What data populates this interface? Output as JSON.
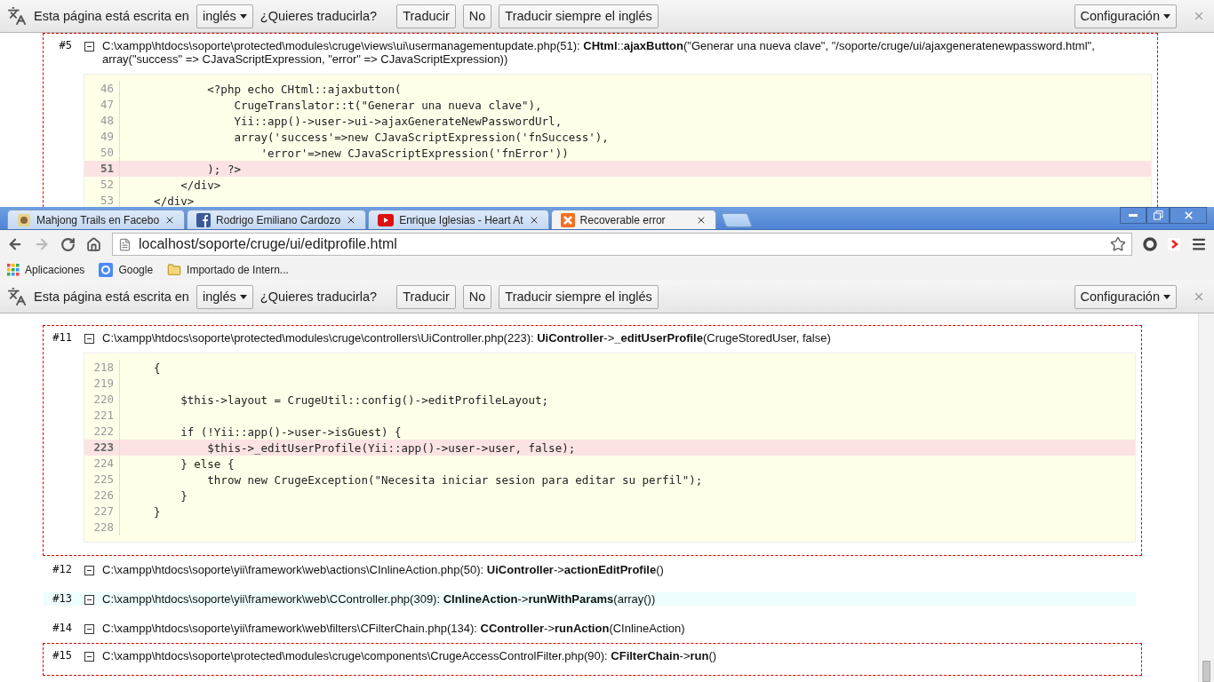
{
  "background_window": {
    "translate_bar": {
      "message": "Esta página está escrita en",
      "language": "inglés",
      "question": "¿Quieres traducirla?",
      "buttons": [
        "Traducir",
        "No",
        "Traducir siempre el inglés"
      ],
      "settings": "Configuración"
    },
    "traces": [
      {
        "number": "#5",
        "kind": "app",
        "highlighted": false,
        "file": "C:\\xampp\\htdocs\\soporte\\protected\\modules\\cruge\\views\\ui\\usermanagementupdate.php(51):",
        "call": "**CHtml**::**ajaxButton**(\"Generar una nueva clave\", \"/soporte/cruge/ui/ajaxgeneratenewpassword.html\", array(\"success\" => CJavaScriptExpression, \"error\" => CJavaScriptExpression))",
        "code": [
          {
            "line": "46",
            "text": "            <?php echo CHtml::ajaxbutton(",
            "current": false
          },
          {
            "line": "47",
            "text": "                CrugeTranslator::t(\"Generar una nueva clave\"),",
            "current": false
          },
          {
            "line": "48",
            "text": "                Yii::app()->user->ui->ajaxGenerateNewPasswordUrl,",
            "current": false
          },
          {
            "line": "49",
            "text": "                array('success'=>new CJavaScriptExpression('fnSuccess'),",
            "current": false
          },
          {
            "line": "50",
            "text": "                    'error'=>new CJavaScriptExpression('fnError'))",
            "current": false
          },
          {
            "line": "51",
            "text": "            ); ?>",
            "current": true
          },
          {
            "line": "52",
            "text": "        </div>",
            "current": false
          },
          {
            "line": "53",
            "text": "    </div>",
            "current": false
          }
        ]
      }
    ]
  },
  "browser": {
    "tabs": [
      {
        "kind": "game",
        "title": "Mahjong Trails en Facebo",
        "selected": false
      },
      {
        "kind": "social",
        "title": "Rodrigo Emiliano Cardozo",
        "selected": false
      },
      {
        "kind": "video",
        "title": "Enrique Iglesias - Heart At",
        "selected": false
      },
      {
        "kind": "server",
        "title": "Recoverable error",
        "selected": true
      }
    ],
    "back_enabled": true,
    "forward_enabled": false,
    "address": "localhost/soporte/cruge/ui/editprofile.html",
    "bookmarks": [
      {
        "kind": "apps",
        "label": "Aplicaciones"
      },
      {
        "kind": "search",
        "label": "Google"
      },
      {
        "kind": "folder",
        "label": "Importado de Intern..."
      }
    ],
    "translate_bar": {
      "message": "Esta página está escrita en",
      "language": "inglés",
      "question": "¿Quieres traducirla?",
      "buttons": [
        "Traducir",
        "No",
        "Traducir siempre el inglés"
      ],
      "settings": "Configuración"
    },
    "traces": [
      {
        "number": "#11",
        "kind": "app",
        "highlighted": false,
        "file": "C:\\xampp\\htdocs\\soporte\\protected\\modules\\cruge\\controllers\\UiController.php(223):",
        "call": "**UiController**->**_editUserProfile**(CrugeStoredUser, false)",
        "code": [
          {
            "line": "218",
            "text": "    {",
            "current": false
          },
          {
            "line": "219",
            "current": false
          },
          {
            "line": "220",
            "text": "        $this->layout = CrugeUtil::config()->editProfileLayout;",
            "current": false
          },
          {
            "line": "221",
            "current": false
          },
          {
            "line": "222",
            "text": "        if (!Yii::app()->user->isGuest) {",
            "current": false
          },
          {
            "line": "223",
            "text": "            $this->_editUserProfile(Yii::app()->user->user, false);",
            "current": true
          },
          {
            "line": "224",
            "text": "        } else {",
            "current": false
          },
          {
            "line": "225",
            "text": "            throw new CrugeException(\"Necesita iniciar sesion para editar su perfil\");",
            "current": false
          },
          {
            "line": "226",
            "text": "        }",
            "current": false
          },
          {
            "line": "227",
            "text": "    }",
            "current": false
          },
          {
            "line": "228",
            "current": false
          }
        ]
      },
      {
        "number": "#12",
        "kind": "core",
        "highlighted": false,
        "file": "C:\\xampp\\htdocs\\soporte\\yii\\framework\\web\\actions\\CInlineAction.php(50):",
        "call": "**UiController**->**actionEditProfile**()"
      },
      {
        "number": "#13",
        "kind": "core",
        "highlighted": true,
        "file": "C:\\xampp\\htdocs\\soporte\\yii\\framework\\web\\CController.php(309):",
        "call": "**CInlineAction**->**runWithParams**(array())"
      },
      {
        "number": "#14",
        "kind": "core",
        "highlighted": false,
        "file": "C:\\xampp\\htdocs\\soporte\\yii\\framework\\web\\filters\\CFilterChain.php(134):",
        "call": "**CController**->**runAction**(CInlineAction)"
      },
      {
        "number": "#15",
        "kind": "app",
        "highlighted": false,
        "file": "C:\\xampp\\htdocs\\soporte\\protected\\modules\\cruge\\components\\CrugeAccessControlFilter.php(90):",
        "call": "**CFilterChain**->**run**()"
      }
    ]
  }
}
